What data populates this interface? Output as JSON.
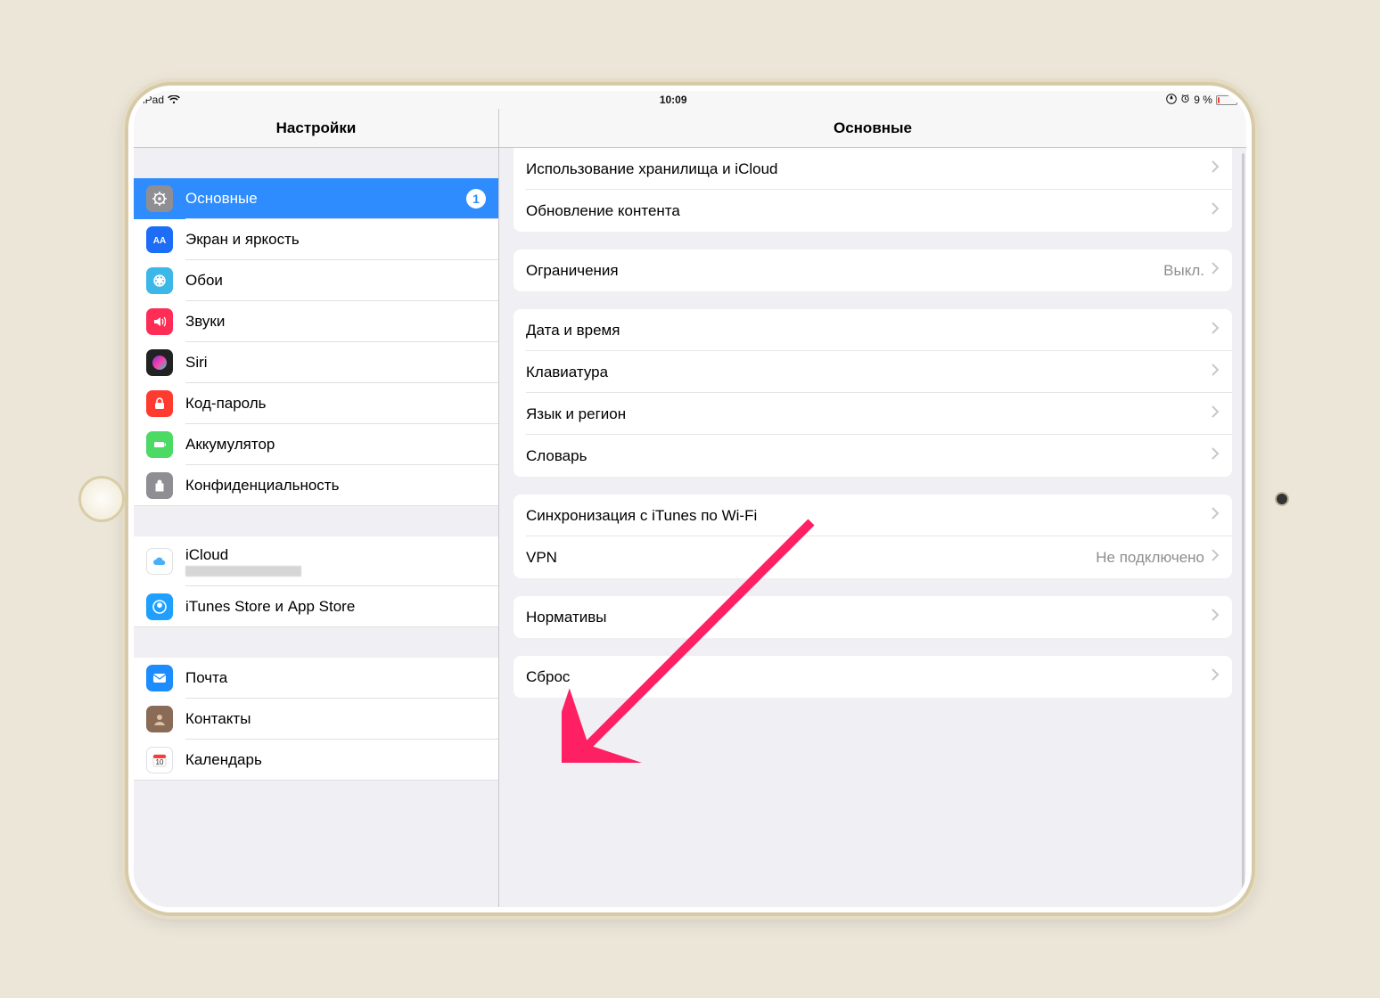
{
  "status": {
    "carrier": "iPad",
    "time": "10:09",
    "battery_pct": "9 %"
  },
  "sidebar": {
    "title": "Настройки",
    "groups": [
      {
        "items": [
          {
            "key": "general",
            "label": "Основные",
            "icon_bg": "#8e8e93",
            "selected": true,
            "badge": "1"
          },
          {
            "key": "display",
            "label": "Экран и яркость",
            "icon_bg": "#1e6df6"
          },
          {
            "key": "wallpaper",
            "label": "Обои",
            "icon_bg": "#3bb8e8"
          },
          {
            "key": "sounds",
            "label": "Звуки",
            "icon_bg": "#ff2d55"
          },
          {
            "key": "siri",
            "label": "Siri",
            "icon_bg": "#222"
          },
          {
            "key": "passcode",
            "label": "Код-пароль",
            "icon_bg": "#ff3b30"
          },
          {
            "key": "battery",
            "label": "Аккумулятор",
            "icon_bg": "#4cd964"
          },
          {
            "key": "privacy",
            "label": "Конфиденциальность",
            "icon_bg": "#8e8e93"
          }
        ]
      },
      {
        "items": [
          {
            "key": "icloud",
            "label": "iCloud",
            "icon_bg": "#ffffff",
            "subtitle_blur": true
          },
          {
            "key": "stores",
            "label": "iTunes Store и App Store",
            "icon_bg": "#1fa0ff"
          }
        ]
      },
      {
        "items": [
          {
            "key": "mail",
            "label": "Почта",
            "icon_bg": "#1c8cff"
          },
          {
            "key": "contacts",
            "label": "Контакты",
            "icon_bg": "#8a6b56"
          },
          {
            "key": "calendar",
            "label": "Календарь",
            "icon_bg": "#ffffff"
          }
        ]
      }
    ]
  },
  "detail": {
    "title": "Основные",
    "groups": [
      [
        {
          "key": "storage",
          "label": "Использование хранилища и iCloud"
        },
        {
          "key": "background",
          "label": "Обновление контента"
        }
      ],
      [
        {
          "key": "restrictions",
          "label": "Ограничения",
          "value": "Выкл."
        }
      ],
      [
        {
          "key": "datetime",
          "label": "Дата и время"
        },
        {
          "key": "keyboard",
          "label": "Клавиатура"
        },
        {
          "key": "language",
          "label": "Язык и регион"
        },
        {
          "key": "dictionary",
          "label": "Словарь"
        }
      ],
      [
        {
          "key": "itunessync",
          "label": "Синхронизация с iTunes по Wi-Fi"
        },
        {
          "key": "vpn",
          "label": "VPN",
          "value": "Не подключено"
        }
      ],
      [
        {
          "key": "regulatory",
          "label": "Нормативы"
        }
      ],
      [
        {
          "key": "reset",
          "label": "Сброс"
        }
      ]
    ]
  },
  "annotation": {
    "arrow_color": "#ff1f63"
  }
}
